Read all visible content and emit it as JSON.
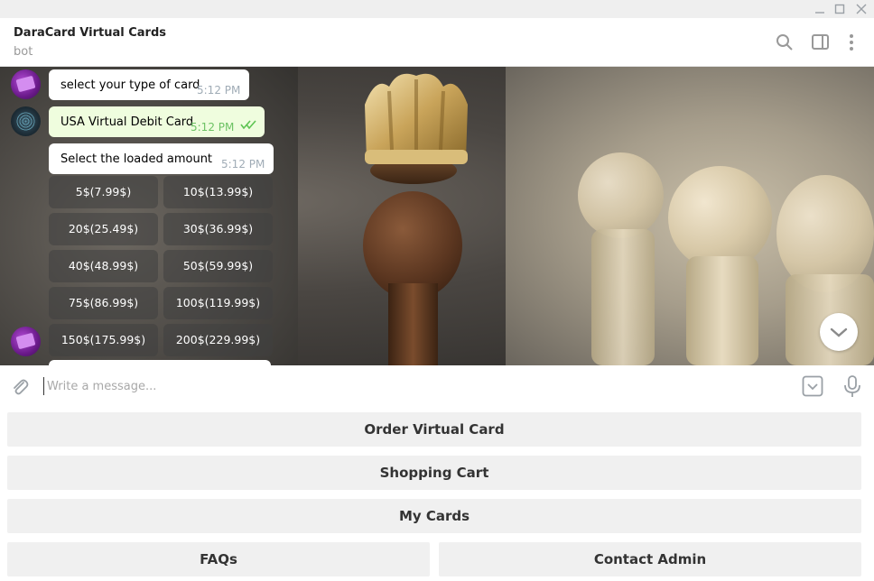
{
  "window": {
    "minimize_glyph": "—",
    "maximize_glyph": "☐",
    "close_glyph": "✕"
  },
  "header": {
    "title": "DaraCard Virtual Cards",
    "subtitle": "bot",
    "icons": [
      "search-icon",
      "sidebar-toggle-icon",
      "more-vertical-icon"
    ]
  },
  "messages": [
    {
      "direction": "in",
      "text": "select your type of card",
      "time": "5:12 PM",
      "avatar": "purple-card"
    },
    {
      "direction": "out",
      "text": "USA Virtual Debit Card",
      "time": "5:12 PM",
      "status": "read",
      "avatar": "dark-dots"
    },
    {
      "direction": "in",
      "text": "Select the loaded amount",
      "time": "5:12 PM"
    }
  ],
  "inline_keyboard": [
    [
      "5$(7.99$)",
      "10$(13.99$)"
    ],
    [
      "20$(25.49$)",
      "30$(36.99$)"
    ],
    [
      "40$(48.99$)",
      "50$(59.99$)"
    ],
    [
      "75$(86.99$)",
      "100$(119.99$)"
    ],
    [
      "150$(175.99$)",
      "200$(229.99$)"
    ]
  ],
  "composer": {
    "placeholder": "Write a message...",
    "value": ""
  },
  "reply_keyboard": {
    "order": "Order Virtual Card",
    "cart": "Shopping Cart",
    "my_cards": "My Cards",
    "faqs": "FAQs",
    "contact": "Contact Admin"
  },
  "colors": {
    "outgoing_bubble": "#effdde",
    "incoming_bubble": "#ffffff",
    "read_ticks": "#5dc452",
    "time_out": "#6dc264"
  }
}
